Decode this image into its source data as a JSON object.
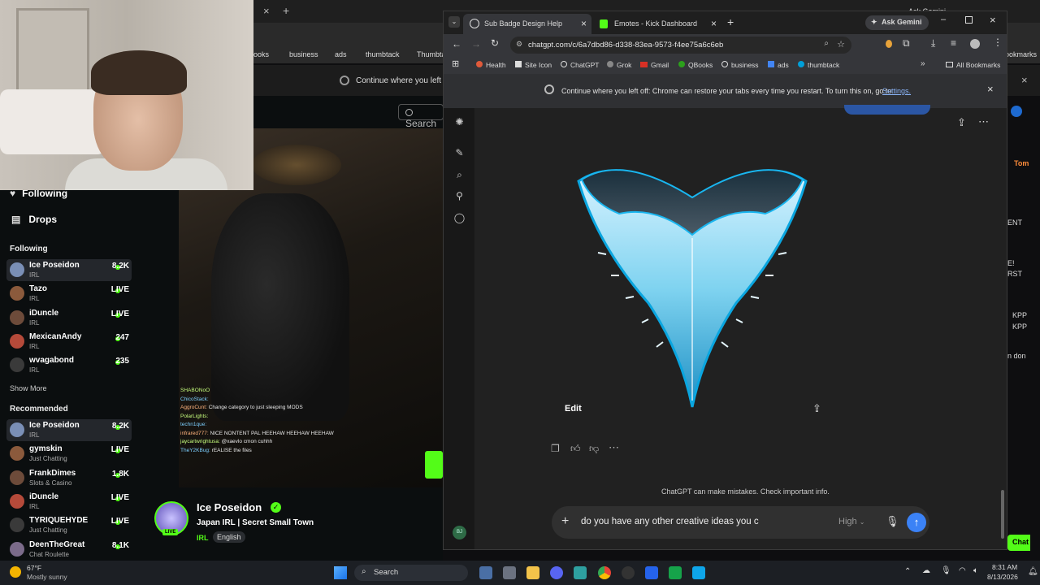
{
  "background_browser": {
    "tab_close": "×",
    "tab_add": "+",
    "bookmarks": [
      "ooks",
      "business",
      "ads",
      "thumbtack",
      "Thumbta"
    ],
    "gemini_label": "Ask Gemini",
    "bookmarks_right": "ookmarks",
    "restore_text": "Continue where you left off:"
  },
  "kick": {
    "search_placeholder": "Search",
    "nav": {
      "following": "Following",
      "drops": "Drops"
    },
    "following_header": "Following",
    "following": [
      {
        "name": "Ice Poseidon",
        "category": "IRL",
        "count": "8.2K"
      },
      {
        "name": "Tazo",
        "category": "IRL",
        "count": "LIVE"
      },
      {
        "name": "iDuncle",
        "category": "IRL",
        "count": "LIVE"
      },
      {
        "name": "MexicanAndy",
        "category": "IRL",
        "count": "247"
      },
      {
        "name": "wvagabond",
        "category": "IRL",
        "count": "235"
      }
    ],
    "show_more": "Show More",
    "recommended_header": "Recommended",
    "recommended": [
      {
        "name": "Ice Poseidon",
        "category": "IRL",
        "count": "8.2K"
      },
      {
        "name": "gymskin",
        "category": "Just Chatting",
        "count": "LIVE"
      },
      {
        "name": "FrankDimes",
        "category": "Slots & Casino",
        "count": "1.8K"
      },
      {
        "name": "iDuncle",
        "category": "IRL",
        "count": "LIVE"
      },
      {
        "name": "TYRIQUEHYDE",
        "category": "Just Chatting",
        "count": "LIVE"
      },
      {
        "name": "DeenTheGreat",
        "category": "Chat Roulette",
        "count": "8.1K"
      }
    ],
    "stream_chat": [
      {
        "user": "SHABONoO",
        "msg": ""
      },
      {
        "user": "ChicoStack:",
        "msg": ""
      },
      {
        "user": "AggroCunt:",
        "msg": "Change category to just sleeping MODS"
      },
      {
        "user": "PolarLights:",
        "msg": ""
      },
      {
        "user": "techn1que:",
        "msg": ""
      },
      {
        "user": "infrared777:",
        "msg": "NICE NONTENT PAL HEEHAW HEEHAW HEEHAW"
      },
      {
        "user": "jaycartwrightusa:",
        "msg": "@xaevlo cmon cuhhh"
      },
      {
        "user": "TheY2KBug:",
        "msg": "rEALISE the files"
      }
    ],
    "streamer": {
      "name": "Ice Poseidon",
      "title": "Japan IRL | Secret Small Town",
      "category": "IRL",
      "language": "English",
      "live_badge": "LIVE"
    },
    "right_panel": {
      "user": "Tom",
      "text1": "ENT",
      "text2": "E!",
      "text3": "RST",
      "text4": "KPP",
      "text5": "KPP",
      "text6": "n don",
      "chat_btn": "Chat"
    }
  },
  "window": {
    "tabs": [
      {
        "label": "Sub Badge Design Help",
        "active": true
      },
      {
        "label": "Emotes - Kick Dashboard",
        "active": false
      }
    ],
    "gemini_label": "Ask Gemini",
    "url": "chatgpt.com/c/6a7dbd86-d338-83ea-9573-f4ee75a6c6eb",
    "bookmarks": [
      "Health",
      "Site Icon",
      "ChatGPT",
      "Grok",
      "Gmail",
      "QBooks",
      "business",
      "ads",
      "thumbtack"
    ],
    "all_bookmarks": "All Bookmarks",
    "restore_text": "Continue where you left off: Chrome can restore your tabs every time you restart. To turn this on, go to",
    "restore_link": "Settings."
  },
  "chatgpt": {
    "edit_label": "Edit",
    "disclaimer": "ChatGPT can make mistakes. Check important info.",
    "input_value": "do you have any other creative ideas you c",
    "model_label": "High",
    "user_initials": "BJ"
  },
  "taskbar": {
    "weather_temp": "67°F",
    "weather_desc": "Mostly sunny",
    "search_label": "Search",
    "time": "8:31 AM",
    "date": "8/13/2026"
  },
  "colors": {
    "kick_green": "#53fc18",
    "send_button": "#3b82f6"
  }
}
